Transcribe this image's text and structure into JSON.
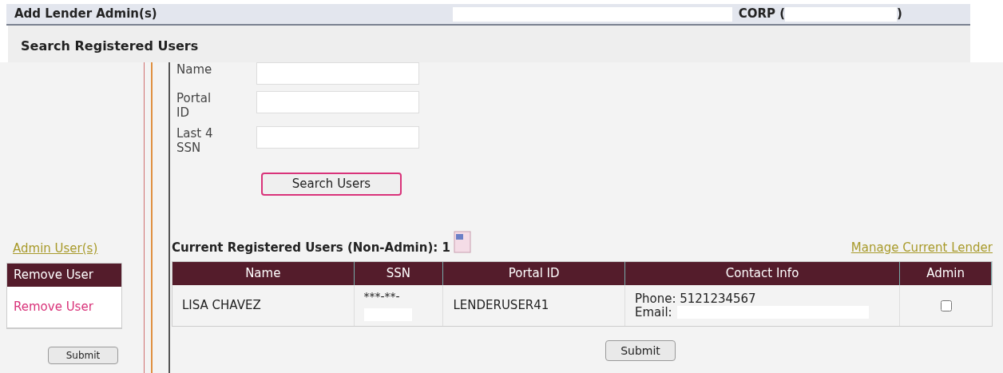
{
  "header": {
    "title": "Add Lender Admin(s)",
    "org_prefix": "CORP (",
    "org_suffix": ")"
  },
  "search": {
    "title": "Search Registered Users",
    "fields": [
      {
        "label": "Name"
      },
      {
        "label": "Portal ID"
      },
      {
        "label": "Last 4 SSN"
      }
    ],
    "button": "Search Users"
  },
  "admins": {
    "link": "Admin User(s)",
    "columns": [
      "Remove User"
    ],
    "rows": [
      {
        "action": "Remove User"
      }
    ],
    "submit": "Submit"
  },
  "users": {
    "title": "Current Registered Users (Non-Admin): 1",
    "manage_link": "Manage Current Lender",
    "columns": [
      "Name",
      "SSN",
      "Portal ID",
      "Contact Info",
      "Admin"
    ],
    "rows": [
      {
        "name": "LISA CHAVEZ",
        "ssn": "***-**-",
        "portal_id": "LENDERUSER41",
        "phone": "Phone: 5121234567",
        "email": "Email:",
        "admin": false
      }
    ],
    "submit": "Submit"
  }
}
